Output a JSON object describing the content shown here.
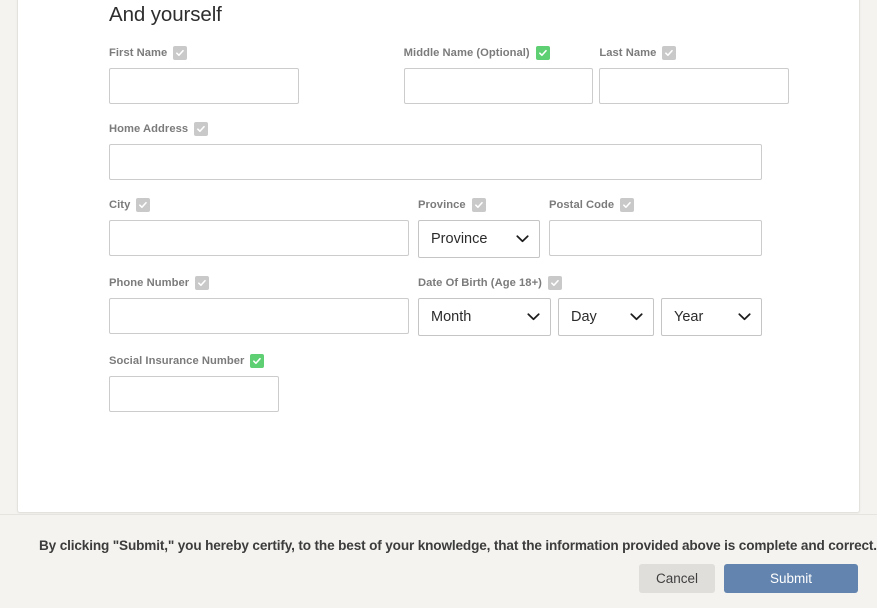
{
  "section": {
    "title": "And yourself"
  },
  "fields": {
    "first_name": {
      "label": "First Name",
      "value": "",
      "check": "gray"
    },
    "middle_name": {
      "label": "Middle Name (Optional)",
      "value": "",
      "check": "green"
    },
    "last_name": {
      "label": "Last Name",
      "value": "",
      "check": "gray"
    },
    "home_address": {
      "label": "Home Address",
      "value": "",
      "check": "gray"
    },
    "city": {
      "label": "City",
      "value": "",
      "check": "gray"
    },
    "province": {
      "label": "Province",
      "value": "Province",
      "check": "gray"
    },
    "postal_code": {
      "label": "Postal Code",
      "value": "",
      "check": "gray"
    },
    "phone_number": {
      "label": "Phone Number",
      "value": "",
      "check": "gray"
    },
    "date_of_birth": {
      "label": "Date Of Birth (Age 18+)",
      "check": "gray",
      "month": "Month",
      "day": "Day",
      "year": "Year"
    },
    "sin": {
      "label": "Social Insurance Number",
      "value": "",
      "check": "green"
    }
  },
  "footer": {
    "certification": "By clicking \"Submit,\" you hereby certify, to the best of your knowledge, that the information provided above is complete and correct.",
    "cancel_label": "Cancel",
    "submit_label": "Submit"
  },
  "colors": {
    "check_green": "#5ed073",
    "check_gray": "#c9c9c9",
    "submit_blue": "#6284ae",
    "cancel_gray": "#e0dedb",
    "page_bg": "#f4f3ef",
    "card_bg": "#ffffff",
    "label_gray": "#7b7b7b"
  },
  "icons": {
    "checkmark": "checkmark-icon",
    "chevron": "chevron-down-icon"
  }
}
